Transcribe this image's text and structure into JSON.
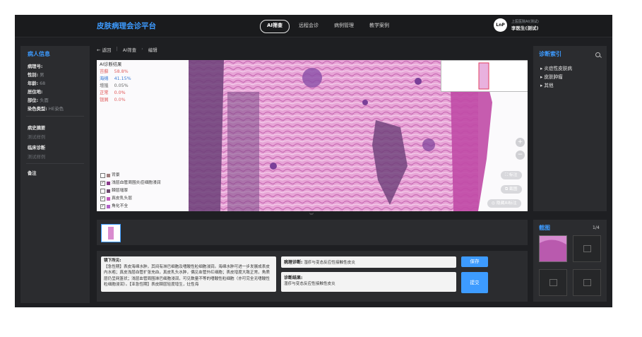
{
  "app": {
    "title": "皮肤病理会诊平台"
  },
  "nav": {
    "tabs": [
      {
        "label": "AI筛查",
        "active": true
      },
      {
        "label": "远程会诊"
      },
      {
        "label": "病例管理"
      },
      {
        "label": "教学案例"
      }
    ]
  },
  "user": {
    "org": "上医医院AI(测试)",
    "name": "李医生(测试)",
    "logo": "LnP"
  },
  "patient": {
    "title": "病人信息",
    "fields": [
      {
        "label": "病理号:",
        "value": ""
      },
      {
        "label": "性别:",
        "value": "男"
      },
      {
        "label": "年龄:",
        "value": "68"
      },
      {
        "label": "居住地:",
        "value": ""
      },
      {
        "label": "部位:",
        "value": "头面"
      },
      {
        "label": "染色类型:",
        "value": "HE染色"
      }
    ],
    "history_label": "病史摘要",
    "history_value": "测试样例",
    "clinical_label": "临床诊断",
    "clinical_value": "测试样例",
    "notes_label": "备注"
  },
  "breadcrumb": {
    "back": "返回",
    "items": [
      "AI筛查",
      "编辑"
    ]
  },
  "ai_result": {
    "title": "AI诊断结果",
    "rows": [
      {
        "label": "苔藓",
        "value": "58.8%",
        "color": "#e06060"
      },
      {
        "label": "海绵",
        "value": "41.15%",
        "color": "#3a7bd5"
      },
      {
        "label": "增殖",
        "value": "0.05%",
        "color": "#666666"
      },
      {
        "label": "正常",
        "value": "0.0%",
        "color": "#e05050"
      },
      {
        "label": "银屑",
        "value": "0.0%",
        "color": "#e06060"
      }
    ]
  },
  "legend": [
    {
      "label": "背景",
      "checked": false,
      "color": "#9e7c7c"
    },
    {
      "label": "浅层血管周围炎症细胞浸润",
      "checked": true,
      "color": "#8b3a8b"
    },
    {
      "label": "棘层增厚",
      "checked": false,
      "color": "#6e4a6e"
    },
    {
      "label": "真皮乳头层",
      "checked": true,
      "color": "#c35bbd"
    },
    {
      "label": "角化不全",
      "checked": true,
      "color": "#b062c8"
    }
  ],
  "tools": {
    "zoom_in": "+",
    "zoom_out": "−",
    "annotate": "标注",
    "screenshot": "截图",
    "hide_ai": "隐藏AI标注"
  },
  "report": {
    "findings_label": "镜下所见:",
    "findings_text": "【急性期】表皮海绵水肿，其间有淋巴细胞及嗜酸性粒细胞浸润。海绵水肿可进一步发展成表皮内水疱；真皮浅层血管扩张充血，真皮乳头水肿，偶见血管外红细胞；表皮增度大致正常，角质层仍呈网篮状；浅层血管周围淋巴细胞浸润，可见数量不等的嗜酸性粒细胞（亦可完全无嗜酸性粒细胞浸润）。【亚急性期】表皮棘层轻度增生，灶性海",
    "diagnosis_label": "病理诊断:",
    "diagnosis_value": "湿疹与变态反应性接触性皮炎",
    "result_label": "诊断结果:",
    "result_value": "湿疹与变态反应性接触性皮炎",
    "save_label": "保存",
    "submit_label": "提交"
  },
  "index": {
    "title": "诊断索引",
    "items": [
      "炎症性皮肤病",
      "皮肤肿瘤",
      "其他"
    ]
  },
  "screenshots": {
    "title": "截图",
    "count": "1/4"
  }
}
